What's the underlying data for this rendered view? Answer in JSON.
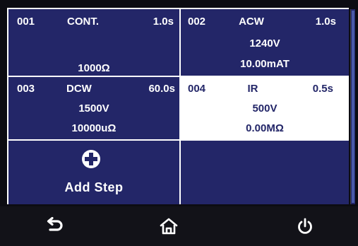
{
  "steps": [
    {
      "num": "001",
      "type": "CONT.",
      "time": "1.0s",
      "val1": "",
      "val2": "1000Ω",
      "selected": false
    },
    {
      "num": "002",
      "type": "ACW",
      "time": "1.0s",
      "val1": "1240V",
      "val2": "10.00mAT",
      "selected": false
    },
    {
      "num": "003",
      "type": "DCW",
      "time": "60.0s",
      "val1": "1500V",
      "val2": "10000uΩ",
      "selected": false
    },
    {
      "num": "004",
      "type": "IR",
      "time": "0.5s",
      "val1": "500V",
      "val2": "0.00MΩ",
      "selected": true
    }
  ],
  "add_step": {
    "label": "Add Step",
    "icon": "plus-circle-icon"
  },
  "nav": {
    "back_icon": "back-arrow-icon",
    "home_icon": "home-icon",
    "power_icon": "power-icon"
  },
  "colors": {
    "cell_bg": "#232668",
    "selected_bg": "#ffffff",
    "grid_line": "#ffffff",
    "bottom_bar": "#121218"
  }
}
